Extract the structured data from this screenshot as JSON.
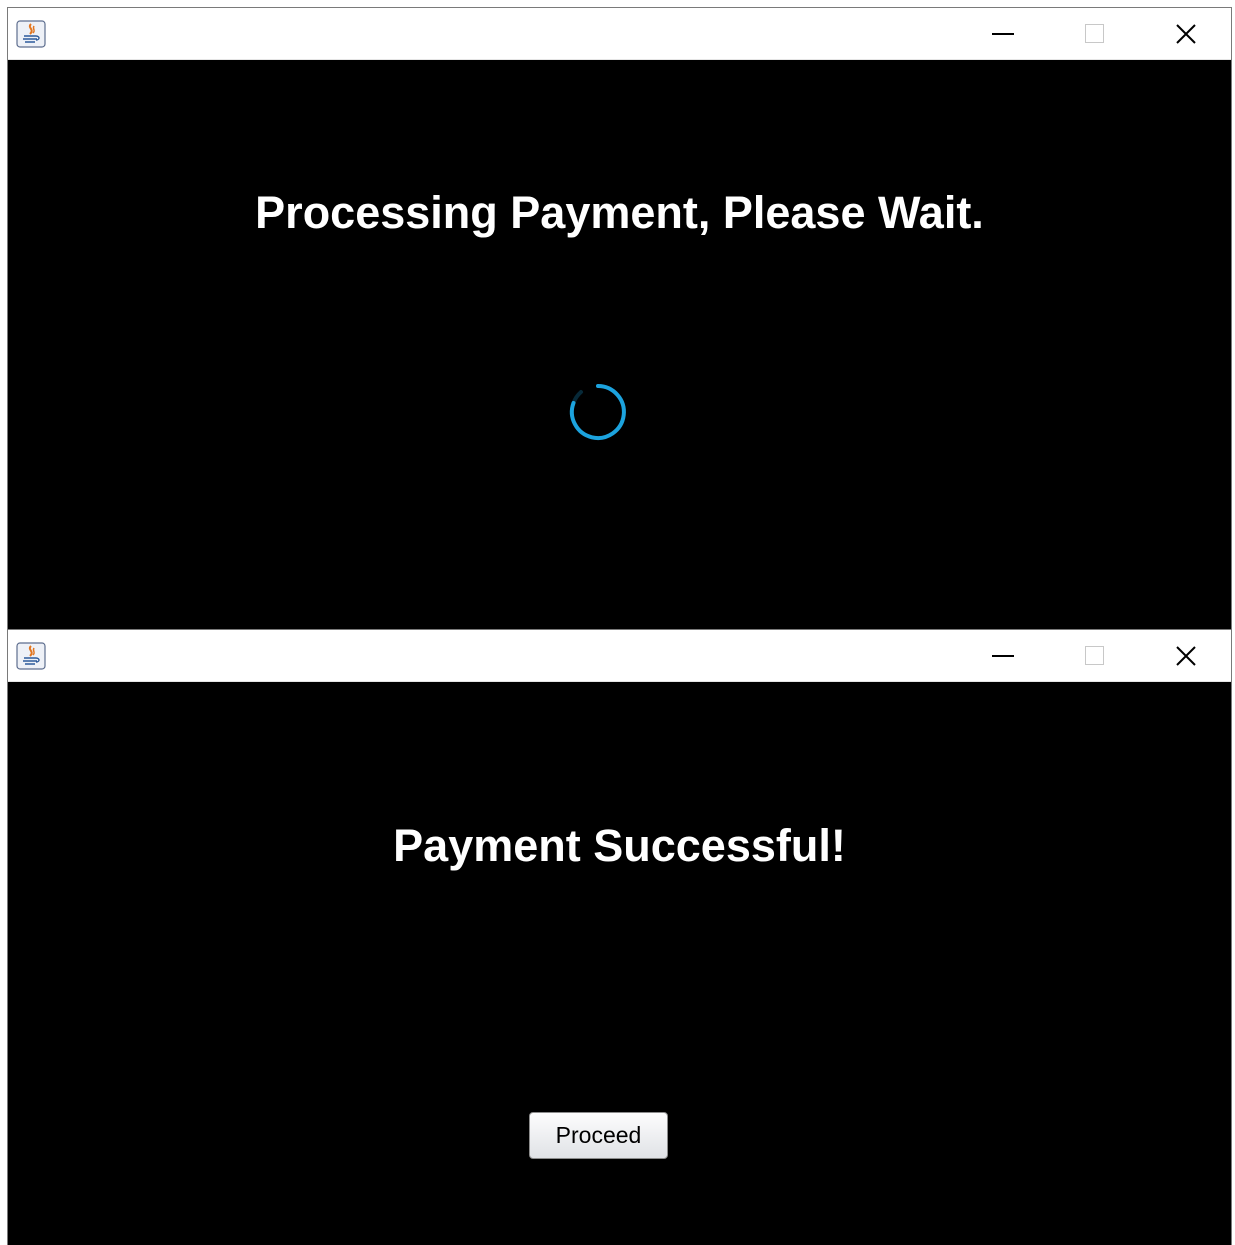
{
  "windows": [
    {
      "title": "",
      "heading": "Processing Payment, Please Wait.",
      "spinner": {
        "color": "#1ca3de",
        "icon": "loading-spinner-icon"
      }
    },
    {
      "title": "",
      "heading": "Payment Successful!",
      "button": {
        "label": "Proceed"
      }
    }
  ],
  "controls": {
    "minimize_icon": "minimize-icon",
    "maximize_icon": "maximize-icon",
    "close_icon": "close-icon"
  },
  "theme": {
    "content_background": "#000000",
    "heading_color": "#ffffff",
    "titlebar_background": "#ffffff"
  }
}
